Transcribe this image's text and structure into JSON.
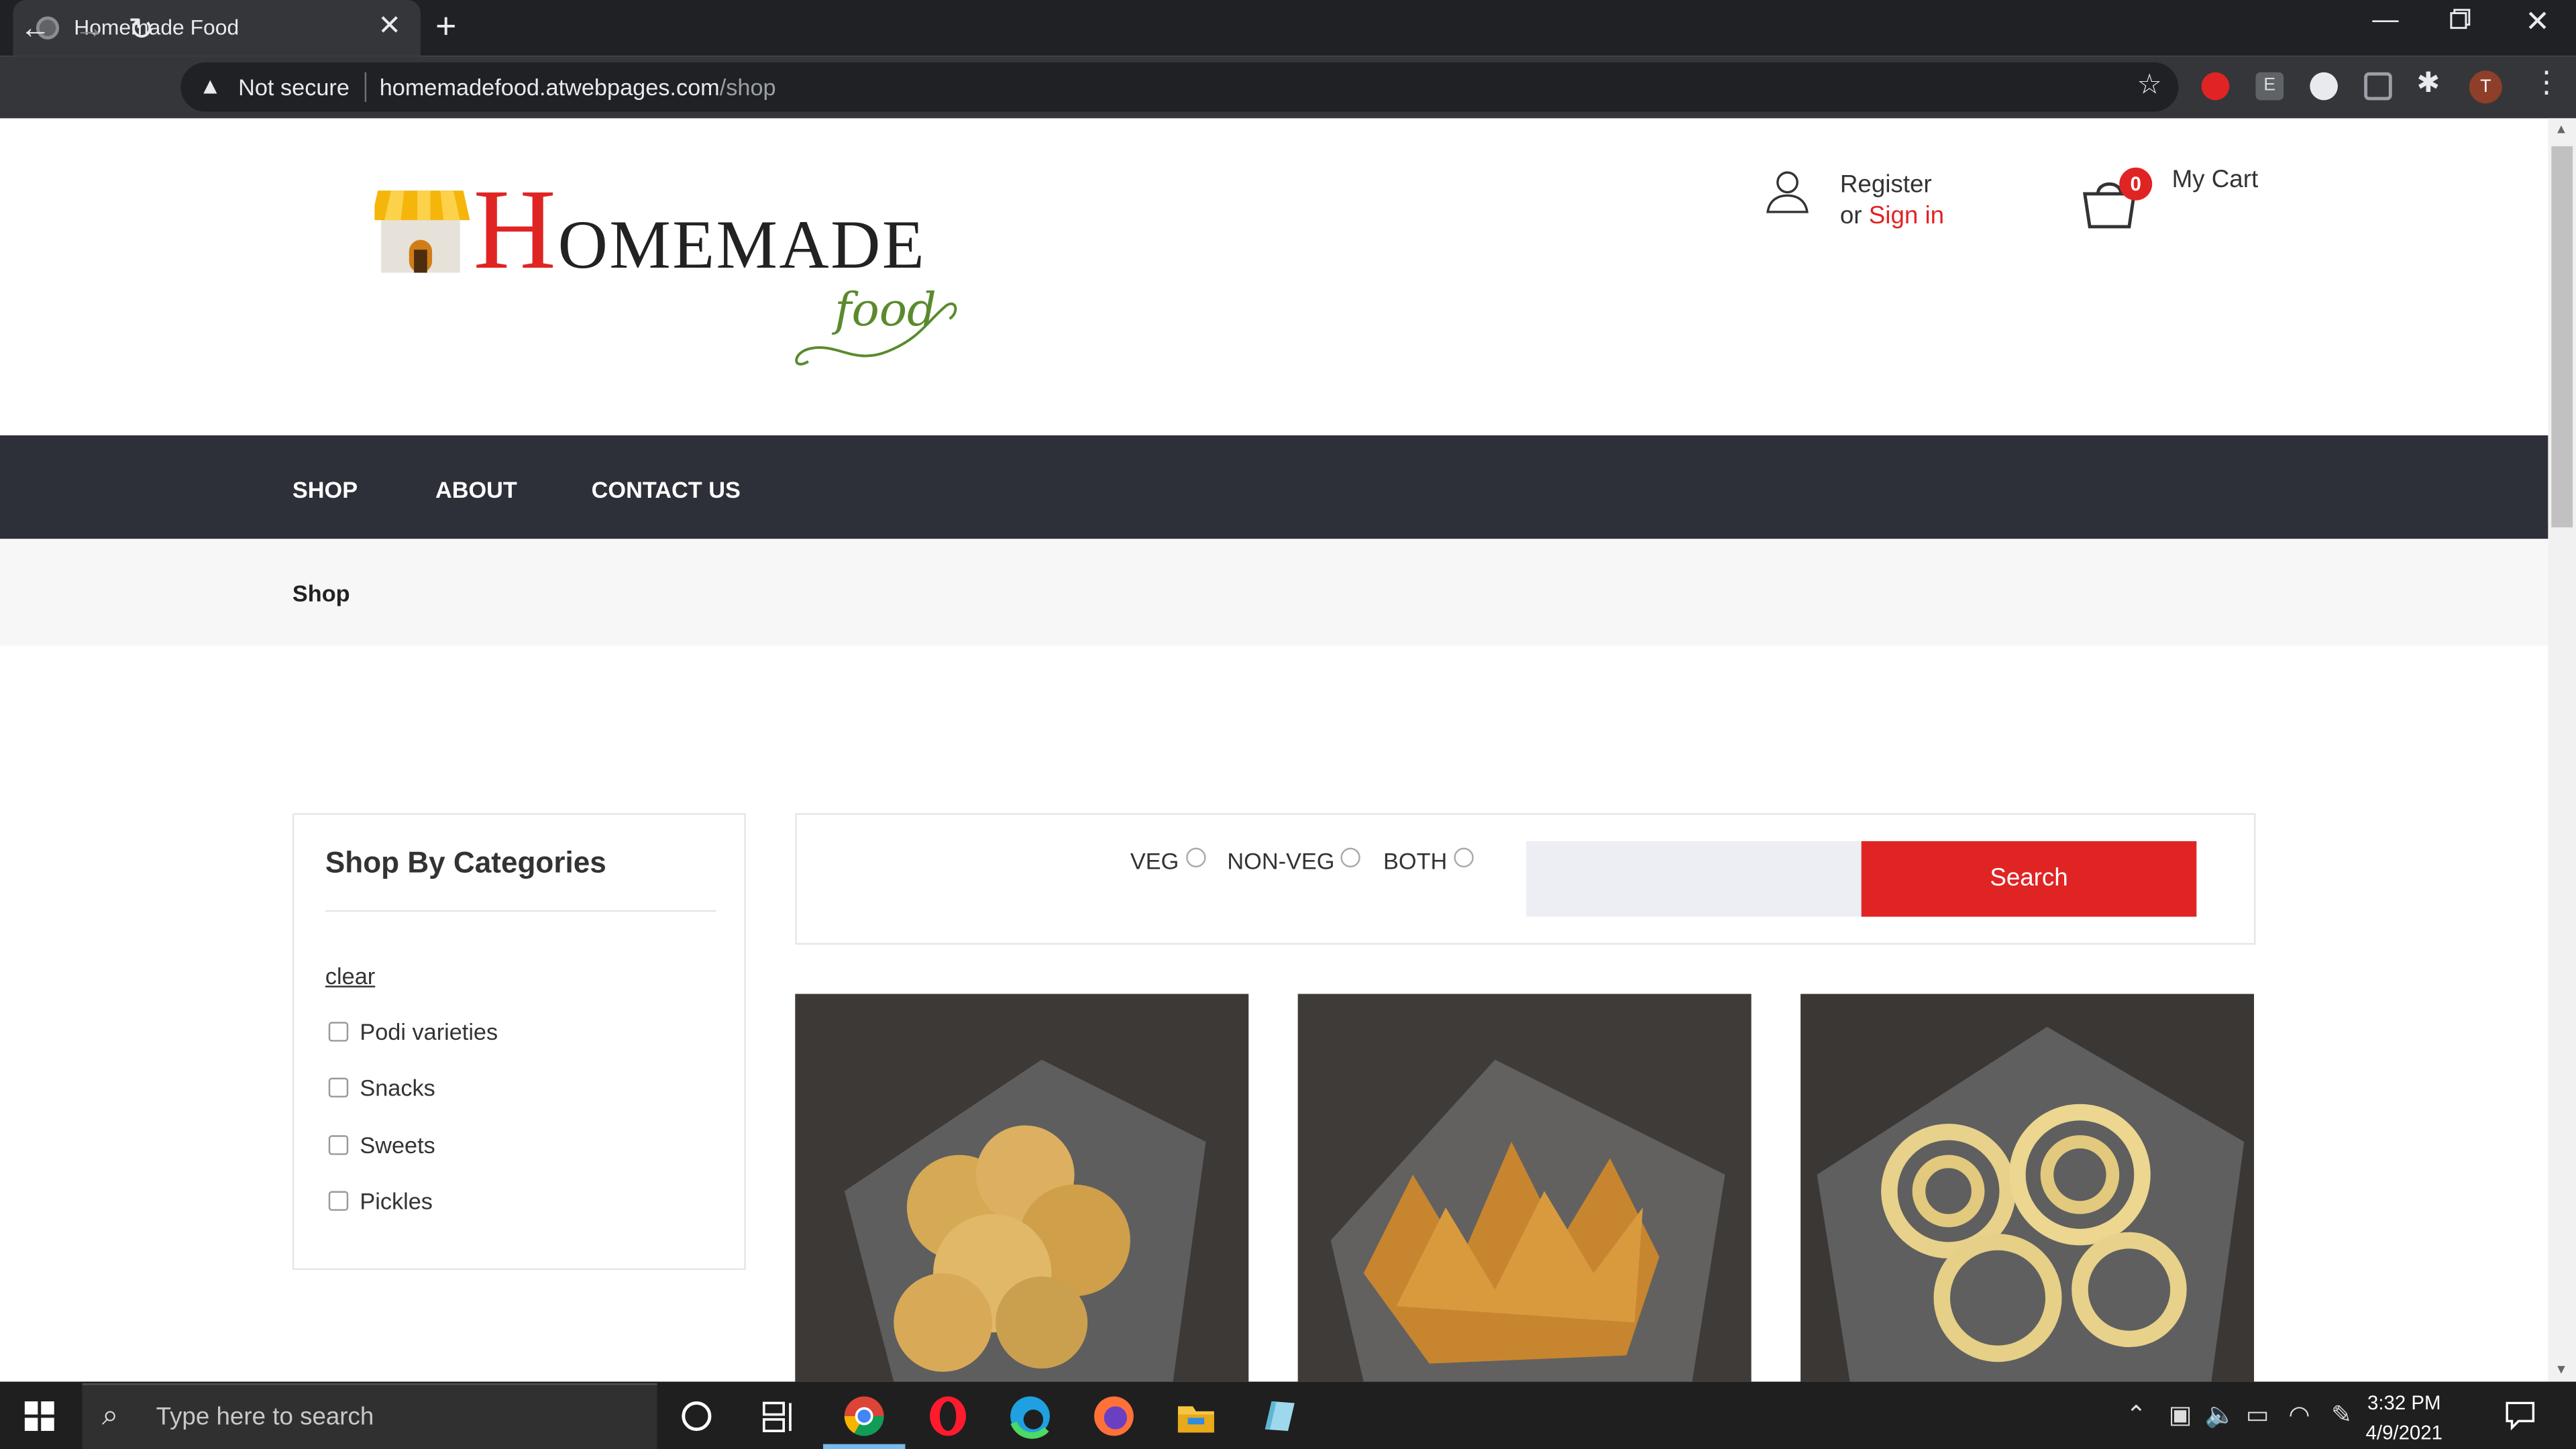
{
  "browser": {
    "tab_title": "Homemade Food",
    "tab_close": "✕",
    "new_tab": "+",
    "security_label": "Not secure",
    "url_host": "homemadefood.atwebpages.com",
    "url_path": "/shop",
    "profile_initial": "T",
    "ext_e_label": "E"
  },
  "header": {
    "logo_main_initial": "H",
    "logo_main_rest": "OMEMADE",
    "logo_sub": "food",
    "register_label": "Register",
    "or_label": "or ",
    "signin_label": "Sign in",
    "cart_count": "0",
    "cart_label": "My Cart"
  },
  "nav": {
    "items": [
      "SHOP",
      "ABOUT",
      "CONTACT US"
    ]
  },
  "breadcrumb": {
    "current": "Shop"
  },
  "sidebar": {
    "title": "Shop By Categories",
    "clear_label": "clear",
    "categories": [
      "Podi varieties",
      "Snacks",
      "Sweets",
      "Pickles"
    ]
  },
  "filters": {
    "options": [
      "VEG",
      "NON-VEG",
      "BOTH"
    ],
    "search_value": "",
    "search_button": "Search"
  },
  "products": [
    {
      "image": "round fried snack chips in a clear plastic bag"
    },
    {
      "image": "fried ribbon snack strips in a clear plastic bag"
    },
    {
      "image": "murukku spirals in a clear plastic bag"
    }
  ],
  "taskbar": {
    "search_placeholder": "Type here to search",
    "time": "3:32 PM",
    "date": "4/9/2021"
  },
  "colors": {
    "brand_red": "#e02424",
    "nav_dark": "#2d3039",
    "logo_green": "#5a8a2e"
  }
}
